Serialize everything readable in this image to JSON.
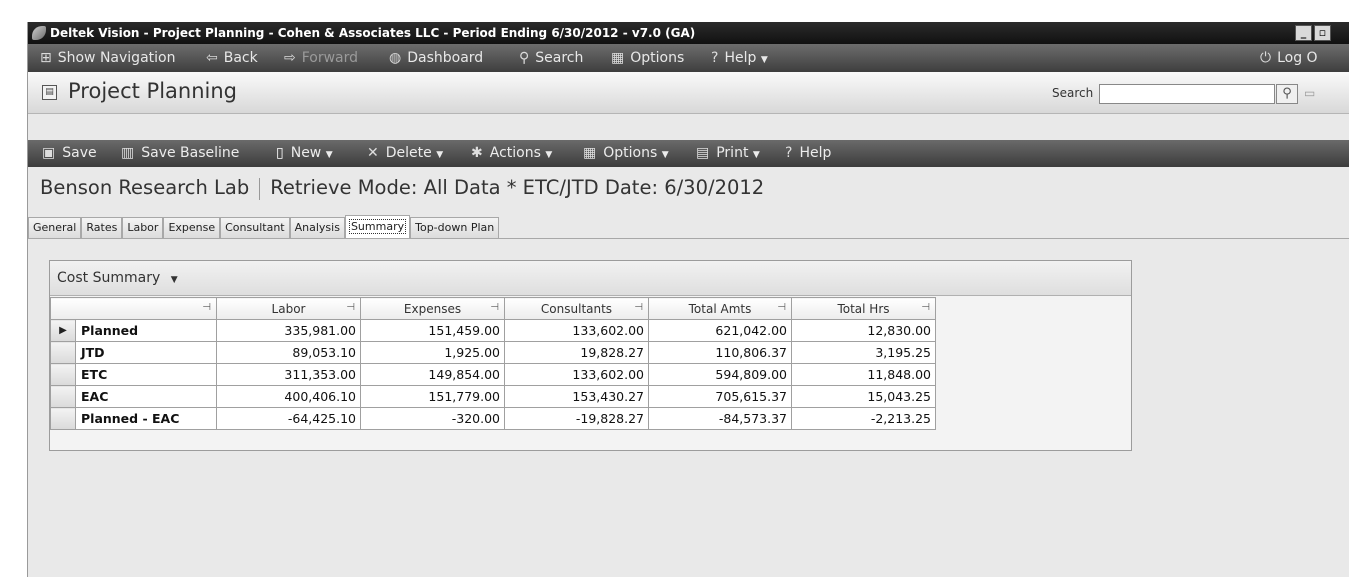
{
  "window": {
    "title": "Deltek Vision - Project Planning - Cohen & Associates LLC - Period Ending 6/30/2012 - v7.0 (GA)",
    "min_glyph": "_",
    "max_glyph": "▫"
  },
  "topnav": {
    "show_navigation": "Show Navigation",
    "back": "Back",
    "forward": "Forward",
    "dashboard": "Dashboard",
    "search": "Search",
    "options": "Options",
    "help": "Help",
    "logout": "Log O"
  },
  "app": {
    "title": "Project Planning",
    "search_label": "Search",
    "search_value": ""
  },
  "toolbar": {
    "save": "Save",
    "save_baseline": "Save Baseline",
    "new": "New",
    "delete": "Delete",
    "actions": "Actions",
    "options": "Options",
    "print": "Print",
    "help": "Help"
  },
  "heading": {
    "project": "Benson Research Lab",
    "mode": "Retrieve Mode: All Data * ETC/JTD Date: 6/30/2012"
  },
  "tabs": [
    "General",
    "Rates",
    "Labor",
    "Expense",
    "Consultant",
    "Analysis",
    "Summary",
    "Top-down Plan"
  ],
  "active_tab": "Summary",
  "panel": {
    "title": "Cost Summary"
  },
  "grid": {
    "columns": [
      "Labor",
      "Expenses",
      "Consultants",
      "Total Amts",
      "Total Hrs"
    ],
    "rows": [
      {
        "label": "Planned",
        "values": [
          "335,981.00",
          "151,459.00",
          "133,602.00",
          "621,042.00",
          "12,830.00"
        ]
      },
      {
        "label": "JTD",
        "values": [
          "89,053.10",
          "1,925.00",
          "19,828.27",
          "110,806.37",
          "3,195.25"
        ]
      },
      {
        "label": "ETC",
        "values": [
          "311,353.00",
          "149,854.00",
          "133,602.00",
          "594,809.00",
          "11,848.00"
        ]
      },
      {
        "label": "EAC",
        "values": [
          "400,406.10",
          "151,779.00",
          "153,430.27",
          "705,615.37",
          "15,043.25"
        ]
      },
      {
        "label": "Planned - EAC",
        "values": [
          "-64,425.10",
          "-320.00",
          "-19,828.27",
          "-84,573.37",
          "-2,213.25"
        ]
      }
    ]
  }
}
